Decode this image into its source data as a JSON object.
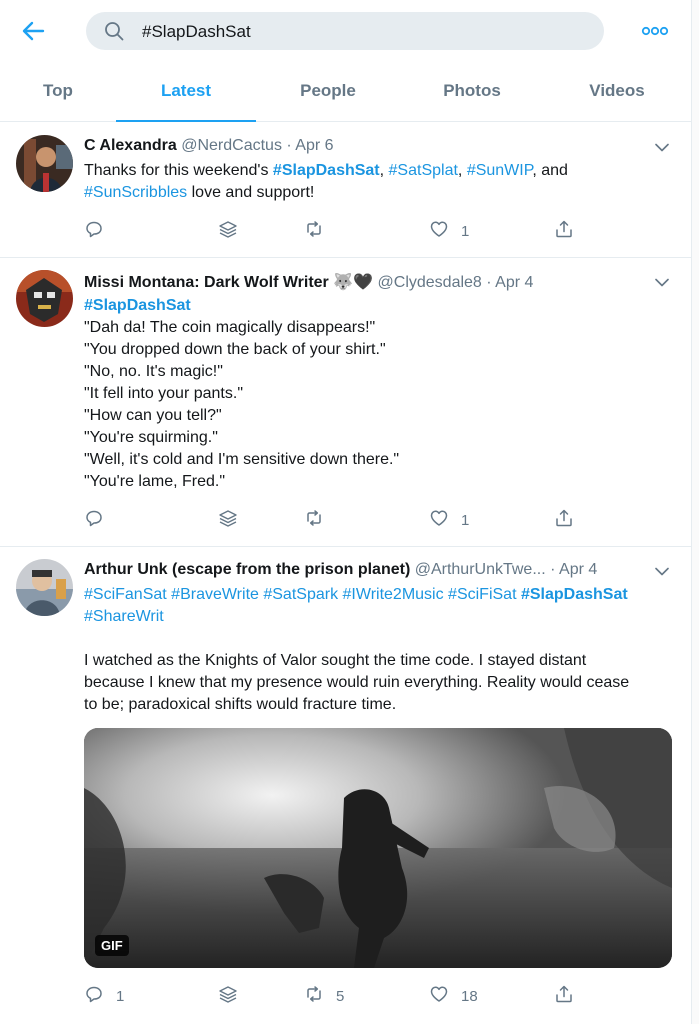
{
  "search": {
    "query": "#SlapDashSat"
  },
  "tabs": [
    "Top",
    "Latest",
    "People",
    "Photos",
    "Videos"
  ],
  "colors": {
    "accent": "#1da1f2",
    "muted": "#657786",
    "divider": "#e6ecf0"
  },
  "icons": {
    "back": "arrow-left-icon",
    "search": "search-icon",
    "more": "more-dots-icon",
    "caret": "chevron-down-icon",
    "reply": "reply-icon",
    "stack": "stack-icon",
    "retweet": "retweet-icon",
    "like": "heart-icon",
    "share": "share-icon"
  },
  "tweets": [
    {
      "name": "C Alexandra",
      "handle": "@NerdCactus",
      "dot": "·",
      "date": "Apr 6",
      "text_parts": [
        {
          "t": "Thanks for this weekend's ",
          "s": "plain"
        },
        {
          "t": "#SlapDashSat",
          "s": "hash-bold"
        },
        {
          "t": ", ",
          "s": "plain"
        },
        {
          "t": "#SatSplat",
          "s": "hash"
        },
        {
          "t": ", ",
          "s": "plain"
        },
        {
          "t": "#SunWIP",
          "s": "hash"
        },
        {
          "t": ", and ",
          "s": "plain"
        },
        {
          "t": "#SunScribbles",
          "s": "hash"
        },
        {
          "t": " love and support!",
          "s": "plain"
        }
      ],
      "replies": "",
      "retweets": "",
      "likes": "1"
    },
    {
      "name": "Missi Montana: Dark Wolf Writer 🐺🖤",
      "handle": "@Clydesdale8",
      "dot": "·",
      "date": "Apr 4",
      "lines": [
        "#SlapDashSat",
        "\"Dah da! The coin magically disappears!\"",
        "\"You dropped down the back of your shirt.\"",
        "\"No, no. It's magic!\"",
        "\"It fell into your pants.\"",
        "\"How can you tell?\"",
        "\"You're squirming.\"",
        "\"Well, it's cold and I'm sensitive down there.\"",
        "\"You're lame, Fred.\""
      ],
      "replies": "",
      "retweets": "",
      "likes": "1"
    },
    {
      "name": "Arthur Unk (escape from the prison planet)",
      "handle": "@ArthurUnkTwe...",
      "dot": "·",
      "date": "Apr 4",
      "hashtags_line1": [
        {
          "t": "#SciFanSat",
          "s": "hash"
        },
        {
          "t": " ",
          "s": "plain"
        },
        {
          "t": "#BraveWrite",
          "s": "hash"
        },
        {
          "t": " ",
          "s": "plain"
        },
        {
          "t": "#SatSpark",
          "s": "hash"
        },
        {
          "t": " ",
          "s": "plain"
        },
        {
          "t": "#IWrite2Music",
          "s": "hash"
        },
        {
          "t": " ",
          "s": "plain"
        },
        {
          "t": "#SciFiSat",
          "s": "hash"
        },
        {
          "t": " ",
          "s": "plain"
        },
        {
          "t": "#SlapDashSat",
          "s": "hash-bold"
        }
      ],
      "hashtags_line2": "#ShareWrit",
      "body_lines": [
        "I watched as the Knights of Valor sought the time code. I stayed distant",
        "because I knew that my presence would ruin everything. Reality would cease",
        "to be; paradoxical shifts would fracture time."
      ],
      "media_badge": "GIF",
      "replies": "1",
      "retweets": "5",
      "likes": "18"
    }
  ]
}
